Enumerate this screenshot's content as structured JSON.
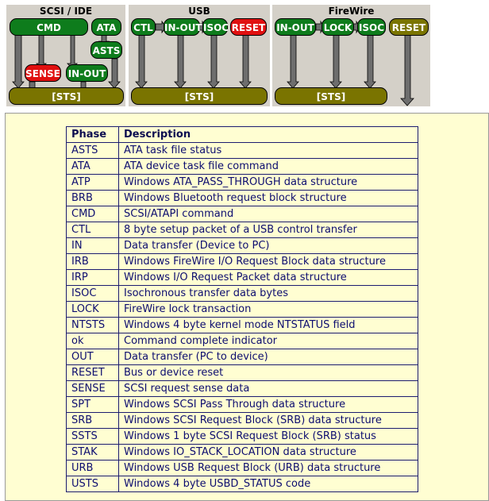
{
  "panels": {
    "scsi": {
      "title": "SCSI / IDE",
      "cmd": "CMD",
      "ata": "ATA",
      "asts": "ASTS",
      "sense": "SENSE",
      "inout": "IN-OUT",
      "sts": "[STS]"
    },
    "usb": {
      "title": "USB",
      "ctl": "CTL",
      "inout": "IN-OUT",
      "isoc": "ISOC",
      "reset": "RESET",
      "sts": "[STS]"
    },
    "firewire": {
      "title": "FireWire",
      "inout": "IN-OUT",
      "lock": "LOCK",
      "isoc": "ISOC",
      "reset": "RESET",
      "sts": "[STS]"
    }
  },
  "colors": {
    "green": "#0e7c1c",
    "red": "#e01010",
    "olive": "#7a7400",
    "panel": "#d4d0c8",
    "info_bg": "#fffed2",
    "table_text": "#0d0d70"
  },
  "table": {
    "headers": [
      "Phase",
      "Description"
    ],
    "rows": [
      [
        "ASTS",
        "ATA task file status"
      ],
      [
        "ATA",
        "ATA device task file command"
      ],
      [
        "ATP",
        "Windows ATA_PASS_THROUGH data structure"
      ],
      [
        "BRB",
        "Windows Bluetooth request block structure"
      ],
      [
        "CMD",
        "SCSI/ATAPI command"
      ],
      [
        "CTL",
        "8 byte setup packet of a USB control transfer"
      ],
      [
        "IN",
        "Data transfer (Device to PC)"
      ],
      [
        "IRB",
        "Windows FireWire I/O Request Block data structure"
      ],
      [
        "IRP",
        "Windows I/O Request Packet data structure"
      ],
      [
        "ISOC",
        "Isochronous transfer data bytes"
      ],
      [
        "LOCK",
        "FireWire lock transaction"
      ],
      [
        "NTSTS",
        "Windows 4 byte kernel mode NTSTATUS field"
      ],
      [
        "ok",
        "Command complete indicator"
      ],
      [
        "OUT",
        "Data transfer (PC to device)"
      ],
      [
        "RESET",
        "Bus or device reset"
      ],
      [
        "SENSE",
        "SCSI request sense data"
      ],
      [
        "SPT",
        "Windows SCSI Pass Through data structure"
      ],
      [
        "SRB",
        "Windows SCSI Request Block (SRB) data structure"
      ],
      [
        "SSTS",
        "Windows 1 byte SCSI Request Block (SRB) status"
      ],
      [
        "STAK",
        "Windows IO_STACK_LOCATION data structure"
      ],
      [
        "URB",
        "Windows USB Request Block (URB) data structure"
      ],
      [
        "USTS",
        "Windows 4 byte USBD_STATUS code"
      ]
    ]
  }
}
